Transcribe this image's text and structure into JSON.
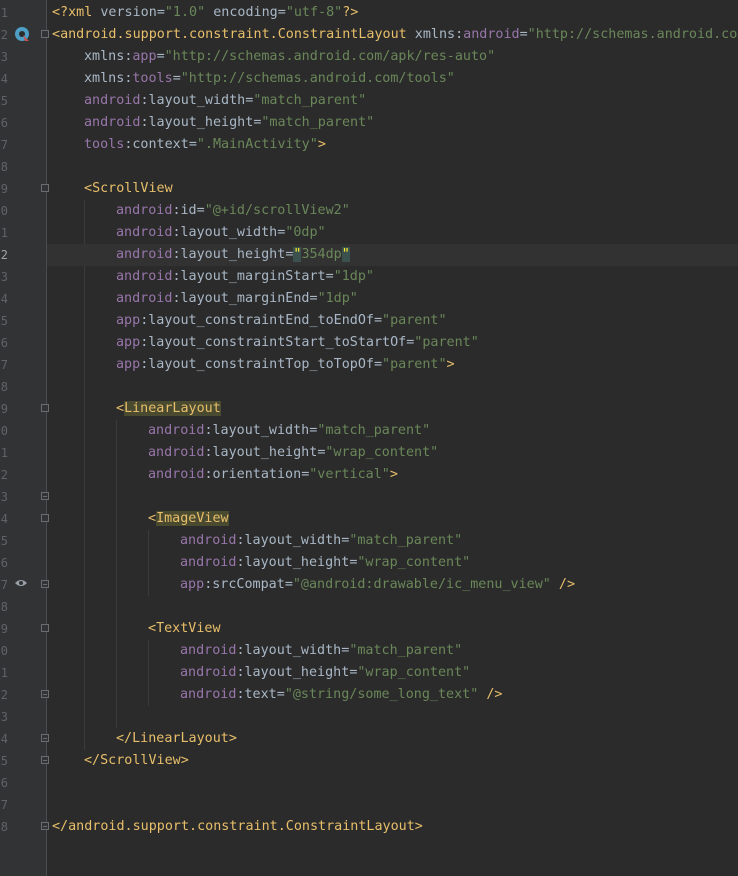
{
  "lineNumbers": [
    "1",
    "2",
    "3",
    "4",
    "5",
    "6",
    "7",
    "8",
    "9",
    "0",
    "1",
    "2",
    "3",
    "4",
    "5",
    "6",
    "7",
    "8",
    "9",
    "0",
    "1",
    "2",
    "3",
    "4",
    "5",
    "6",
    "7",
    "8",
    "9",
    "0",
    "1",
    "2",
    "3",
    "4",
    "5",
    "6",
    "7",
    "8"
  ],
  "code": {
    "l1": {
      "o1": "<?",
      "xml": "xml",
      "sp": " ",
      "a1": "version",
      "eq1": "=",
      "v1": "\"1.0\"",
      "sp2": " ",
      "a2": "encoding",
      "eq2": "=",
      "v2": "\"utf-8\"",
      "c": "?>"
    },
    "l2": {
      "o": "<",
      "tag": "android.support.constraint.ConstraintLayout",
      "sp": " ",
      "ns": "xmlns",
      "col": ":",
      "a": "android",
      "eq": "=",
      "v": "\"http://schemas.android.com"
    },
    "l3": {
      "ns": "xmlns",
      "col": ":",
      "a": "app",
      "eq": "=",
      "v": "\"http://schemas.android.com/apk/res-auto\""
    },
    "l4": {
      "ns": "xmlns",
      "col": ":",
      "a": "tools",
      "eq": "=",
      "v": "\"http://schemas.android.com/tools\""
    },
    "l5": {
      "ns": "android",
      "col": ":",
      "a": "layout_width",
      "eq": "=",
      "v": "\"match_parent\""
    },
    "l6": {
      "ns": "android",
      "col": ":",
      "a": "layout_height",
      "eq": "=",
      "v": "\"match_parent\""
    },
    "l7": {
      "ns": "tools",
      "col": ":",
      "a": "context",
      "eq": "=",
      "v": "\".MainActivity\"",
      "c": ">"
    },
    "l9": {
      "o": "<",
      "tag": "ScrollView"
    },
    "l10": {
      "ns": "android",
      "col": ":",
      "a": "id",
      "eq": "=",
      "v": "\"@+id/scrollView2\""
    },
    "l11": {
      "ns": "android",
      "col": ":",
      "a": "layout_width",
      "eq": "=",
      "v": "\"0dp\""
    },
    "l12": {
      "ns": "android",
      "col": ":",
      "a": "layout_height",
      "eq": "=",
      "q1": "\"",
      "v": "354dp",
      "q2": "\""
    },
    "l13": {
      "ns": "android",
      "col": ":",
      "a": "layout_marginStart",
      "eq": "=",
      "v": "\"1dp\""
    },
    "l14": {
      "ns": "android",
      "col": ":",
      "a": "layout_marginEnd",
      "eq": "=",
      "v": "\"1dp\""
    },
    "l15": {
      "ns": "app",
      "col": ":",
      "a": "layout_constraintEnd_toEndOf",
      "eq": "=",
      "v": "\"parent\""
    },
    "l16": {
      "ns": "app",
      "col": ":",
      "a": "layout_constraintStart_toStartOf",
      "eq": "=",
      "v": "\"parent\""
    },
    "l17": {
      "ns": "app",
      "col": ":",
      "a": "layout_constraintTop_toTopOf",
      "eq": "=",
      "v": "\"parent\"",
      "c": ">"
    },
    "l19": {
      "o": "<",
      "tag": "LinearLayout"
    },
    "l20": {
      "ns": "android",
      "col": ":",
      "a": "layout_width",
      "eq": "=",
      "v": "\"match_parent\""
    },
    "l21": {
      "ns": "android",
      "col": ":",
      "a": "layout_height",
      "eq": "=",
      "v": "\"wrap_content\""
    },
    "l22": {
      "ns": "android",
      "col": ":",
      "a": "orientation",
      "eq": "=",
      "v": "\"vertical\"",
      "c": ">"
    },
    "l24": {
      "o": "<",
      "tag": "ImageView"
    },
    "l25": {
      "ns": "android",
      "col": ":",
      "a": "layout_width",
      "eq": "=",
      "v": "\"match_parent\""
    },
    "l26": {
      "ns": "android",
      "col": ":",
      "a": "layout_height",
      "eq": "=",
      "v": "\"wrap_content\""
    },
    "l27": {
      "ns": "app",
      "col": ":",
      "a": "srcCompat",
      "eq": "=",
      "v": "\"@android:drawable/ic_menu_view\"",
      "c": " />"
    },
    "l29": {
      "o": "<",
      "tag": "TextView"
    },
    "l30": {
      "ns": "android",
      "col": ":",
      "a": "layout_width",
      "eq": "=",
      "v": "\"match_parent\""
    },
    "l31": {
      "ns": "android",
      "col": ":",
      "a": "layout_height",
      "eq": "=",
      "v": "\"wrap_content\""
    },
    "l32": {
      "ns": "android",
      "col": ":",
      "a": "text",
      "eq": "=",
      "v": "\"@string/some_long_text\"",
      "c": " />"
    },
    "l34": {
      "o": "</",
      "tag": "LinearLayout",
      "c": ">"
    },
    "l35": {
      "o": "</",
      "tag": "ScrollView",
      "c": ">"
    },
    "l38": {
      "o": "</",
      "tag": "android.support.constraint.ConstraintLayout",
      "c": ">"
    }
  },
  "icons": [
    "layout-preview-icon",
    "intention-bulb-icon",
    "preview-eye-icon"
  ]
}
